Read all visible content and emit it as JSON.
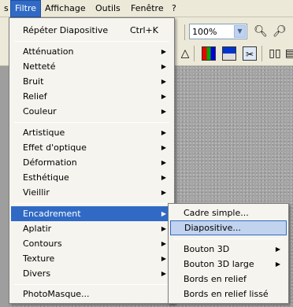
{
  "menubar": {
    "items": [
      "s",
      "Filtre",
      "Affichage",
      "Outils",
      "Fenêtre",
      "?"
    ]
  },
  "toolbar": {
    "zoom_value": "100%"
  },
  "filter_menu": {
    "items": [
      {
        "label": "Répéter Diapositive",
        "shortcut": "Ctrl+K"
      },
      {
        "label": "Atténuation"
      },
      {
        "label": "Netteté"
      },
      {
        "label": "Bruit"
      },
      {
        "label": "Relief"
      },
      {
        "label": "Couleur"
      },
      {
        "label": "Artistique"
      },
      {
        "label": "Effet d'optique"
      },
      {
        "label": "Déformation"
      },
      {
        "label": "Esthétique"
      },
      {
        "label": "Vieillir"
      },
      {
        "label": "Encadrement"
      },
      {
        "label": "Aplatir"
      },
      {
        "label": "Contours"
      },
      {
        "label": "Texture"
      },
      {
        "label": "Divers"
      },
      {
        "label": "PhotoMasque..."
      }
    ]
  },
  "frame_submenu": {
    "items": [
      {
        "label": "Cadre simple..."
      },
      {
        "label": "Diapositive..."
      },
      {
        "label": "Bouton 3D"
      },
      {
        "label": "Bouton 3D large"
      },
      {
        "label": "Bords en relief"
      },
      {
        "label": "Bords en relief lissé"
      }
    ]
  },
  "colors": {
    "highlight": "#316ac5",
    "menu_bg": "#f5f4ee",
    "chrome_bg": "#ece9d8"
  },
  "icons": [
    "zoom-in-icon",
    "zoom-out-icon",
    "arrow-cursor-icon",
    "pan-icon",
    "triangle-tool-icon",
    "rgb-channels-icon",
    "color-adjust-icon",
    "scissors-layer-icon",
    "book-icon",
    "export-icon"
  ]
}
